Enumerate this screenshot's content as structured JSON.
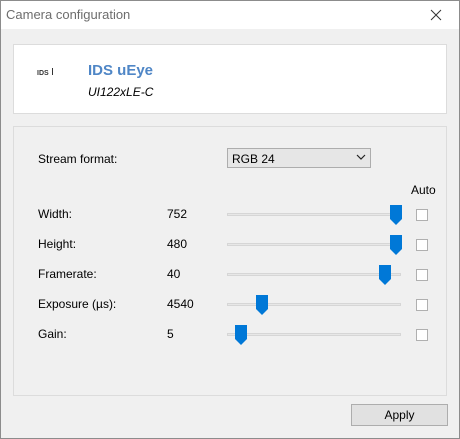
{
  "window": {
    "title": "Camera configuration"
  },
  "camera": {
    "logo_text": "IDS",
    "name": "IDS uEye",
    "model": "UI122xLE-C"
  },
  "stream_format": {
    "label": "Stream format:",
    "selected": "RGB 24"
  },
  "auto_label": "Auto",
  "params": [
    {
      "label": "Width:",
      "value": "752",
      "slider_fraction": 0.97,
      "auto": false
    },
    {
      "label": "Height:",
      "value": "480",
      "slider_fraction": 0.97,
      "auto": false
    },
    {
      "label": "Framerate:",
      "value": "40",
      "slider_fraction": 0.91,
      "auto": false
    },
    {
      "label": "Exposure (µs):",
      "value": "4540",
      "slider_fraction": 0.2,
      "auto": false
    },
    {
      "label": "Gain:",
      "value": "5",
      "slider_fraction": 0.08,
      "auto": false
    }
  ],
  "apply_label": "Apply",
  "colors": {
    "accent": "#0078d7",
    "camera_name": "#4f86c6"
  },
  "icons": {
    "close": "close-icon",
    "dropdown": "chevron-down-icon",
    "slider_thumb": "slider-thumb",
    "logo": "ids-logo"
  }
}
